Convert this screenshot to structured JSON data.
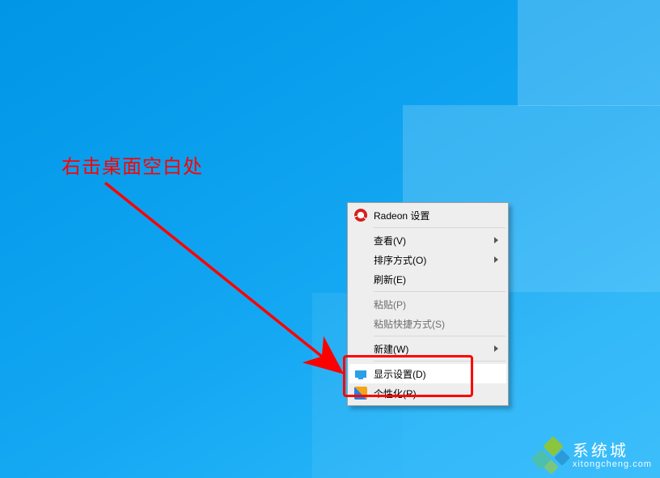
{
  "annotation": {
    "label": "右击桌面空白处"
  },
  "context_menu": {
    "radeon": "Radeon 设置",
    "view": "查看(V)",
    "sort": "排序方式(O)",
    "refresh": "刷新(E)",
    "paste": "粘贴(P)",
    "paste_shortcut": "粘贴快捷方式(S)",
    "new": "新建(W)",
    "display": "显示设置(D)",
    "personalize": "个性化(R)"
  },
  "watermark": {
    "title": "系统城",
    "url": "xitongcheng.com"
  }
}
